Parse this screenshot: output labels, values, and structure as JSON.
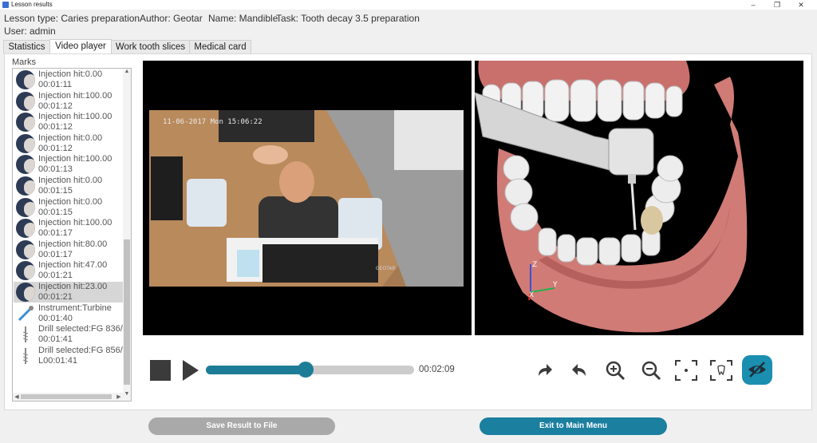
{
  "window": {
    "title": "Lesson results",
    "minimize": "‒",
    "maximize": "❐",
    "close": "✕"
  },
  "info": {
    "lesson_type": "Lesson type: Caries preparation",
    "author": "Author: Geotar",
    "name": "Name: Mandible",
    "task": "Task: Tooth decay 3.5 preparation",
    "user": "User: admin"
  },
  "tabs": [
    {
      "label": "Statistics"
    },
    {
      "label": "Video player"
    },
    {
      "label": "Work tooth slices"
    },
    {
      "label": "Medical card"
    }
  ],
  "marks": {
    "label": "Marks",
    "items": [
      {
        "line1": "Injection hit:0.00",
        "line2": "00:01:11",
        "kind": "injection"
      },
      {
        "line1": "Injection hit:100.00",
        "line2": "00:01:12",
        "kind": "injection"
      },
      {
        "line1": "Injection hit:100.00",
        "line2": "00:01:12",
        "kind": "injection"
      },
      {
        "line1": "Injection hit:0.00",
        "line2": "00:01:12",
        "kind": "injection"
      },
      {
        "line1": "Injection hit:100.00",
        "line2": "00:01:13",
        "kind": "injection"
      },
      {
        "line1": "Injection hit:0.00",
        "line2": "00:01:15",
        "kind": "injection"
      },
      {
        "line1": "Injection hit:0.00",
        "line2": "00:01:15",
        "kind": "injection"
      },
      {
        "line1": "Injection hit:100.00",
        "line2": "00:01:17",
        "kind": "injection"
      },
      {
        "line1": "Injection hit:80.00",
        "line2": "00:01:17",
        "kind": "injection"
      },
      {
        "line1": "Injection hit:47.00",
        "line2": "00:01:21",
        "kind": "injection"
      },
      {
        "line1": "Injection hit:23.00",
        "line2": "00:01:21",
        "kind": "injection"
      },
      {
        "line1": "Instrument:Turbine",
        "line2": "00:01:40",
        "kind": "instrument"
      },
      {
        "line1": "Drill selected:FG 836/",
        "line2": "00:01:41",
        "kind": "drill"
      },
      {
        "line1": "Drill selected:FG 856/",
        "line2": "L00:01:41",
        "kind": "drill"
      }
    ],
    "selected_index": 10
  },
  "video": {
    "timestamp": "11-06-2017 Mon 15:06:22",
    "watermark": "GEOTAR"
  },
  "axes": {
    "z": "Z",
    "y": "Y",
    "x": "X"
  },
  "player": {
    "progress": 0.48,
    "time": "00:02:09"
  },
  "buttons": {
    "save": "Save Result to File",
    "exit": "Exit to Main Menu"
  },
  "colors": {
    "accent": "#1b7fa0",
    "disabled": "#a9a9a9"
  }
}
